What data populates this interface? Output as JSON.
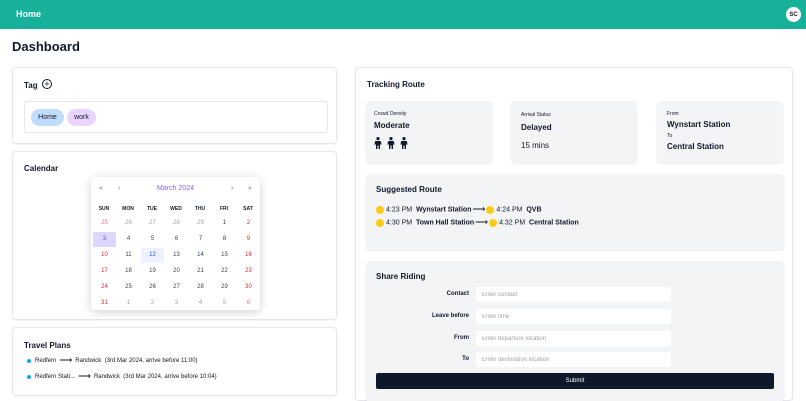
{
  "topbar": {
    "home_label": "Home",
    "avatar_initials": "SC",
    "color": "#17b19a"
  },
  "page": {
    "title": "Dashboard"
  },
  "tag": {
    "title": "Tag",
    "add_icon": "plus-circle-icon",
    "chips": [
      {
        "label": "Home",
        "color": "#bfdbfe"
      },
      {
        "label": "work",
        "color": "#e9d5ff"
      }
    ]
  },
  "calendar": {
    "title": "Calendar",
    "month": "March 2024",
    "nav": {
      "prev_year": "«",
      "prev_month": "‹",
      "next_month": "›",
      "next_year": "»"
    },
    "weekdays": [
      "SUN",
      "MON",
      "TUE",
      "WED",
      "THU",
      "FRI",
      "SAT"
    ],
    "weeks": [
      [
        "25",
        "26",
        "27",
        "28",
        "29",
        "1",
        "2"
      ],
      [
        "3",
        "4",
        "5",
        "6",
        "7",
        "8",
        "9"
      ],
      [
        "10",
        "11",
        "12",
        "13",
        "14",
        "15",
        "16"
      ],
      [
        "17",
        "18",
        "19",
        "20",
        "21",
        "22",
        "23"
      ],
      [
        "24",
        "25",
        "26",
        "27",
        "28",
        "29",
        "30"
      ],
      [
        "31",
        "1",
        "2",
        "3",
        "4",
        "5",
        "6"
      ]
    ],
    "today": "3",
    "selected": "12"
  },
  "travel": {
    "title": "Travel Plans",
    "plans": [
      {
        "from": "Redfern",
        "to": "Randwick",
        "detail": "(3rd Mar 2024, arrive before 11:00)"
      },
      {
        "from": "Redfern Stati...",
        "to": "Randwick",
        "detail": "(3rd Mar 2024, arrive before 10:04)"
      }
    ]
  },
  "tracking": {
    "title": "Tracking Route",
    "crowd": {
      "label": "Crowd Density",
      "value": "Moderate",
      "people_icons": 3
    },
    "arrival": {
      "label": "Arrival Status",
      "value": "Delayed",
      "minutes": "15 mins"
    },
    "from_to": {
      "from_label": "From",
      "from": "Wynstart Station",
      "to_label": "To",
      "to": "Central Station"
    },
    "suggested": {
      "title": "Suggested Route",
      "routes": [
        {
          "t1": "4:23 PM",
          "s1": "Wynstart Station",
          "t2": "4:24 PM",
          "s2": "QVB"
        },
        {
          "t1": "4:30 PM",
          "s1": "Town Hall Station",
          "t2": "4:32 PM",
          "s2": "Central Station"
        }
      ]
    },
    "share": {
      "title": "Share Riding",
      "fields": [
        {
          "label": "Contact",
          "placeholder": "Enter contact"
        },
        {
          "label": "Leave before",
          "placeholder": "Enter time"
        },
        {
          "label": "From",
          "placeholder": "Enter departure location"
        },
        {
          "label": "To",
          "placeholder": "Enter destination location"
        }
      ],
      "submit": "Submit"
    }
  }
}
